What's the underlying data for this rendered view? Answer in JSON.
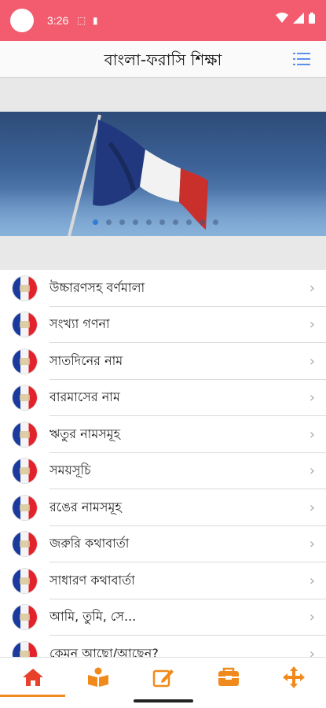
{
  "status_bar": {
    "time": "3:26",
    "icons": [
      "sim-icon",
      "battery-saver-icon",
      "wifi-icon",
      "signal-icon",
      "battery-icon"
    ]
  },
  "app_bar": {
    "title": "বাংলা-ফরাসি শিক্ষা",
    "menu_icon": "list-menu-icon"
  },
  "banner": {
    "image": "french-flag-photo",
    "slide_count": 10,
    "active_slide": 0
  },
  "list": {
    "items": [
      {
        "label": "উচ্চারণসহ বর্ণমালা"
      },
      {
        "label": "সংখ্যা গণনা"
      },
      {
        "label": "সাতদিনের নাম"
      },
      {
        "label": "বারমাসের নাম"
      },
      {
        "label": "ঋতুর নামসমূহ"
      },
      {
        "label": "সময়সূচি"
      },
      {
        "label": "রঙের নামসমূহ"
      },
      {
        "label": "জরুরি কথাবার্তা"
      },
      {
        "label": "সাধারণ কথাবার্তা"
      },
      {
        "label": "আমি, তুমি, সে..."
      },
      {
        "label": "কেমন আছো/আছেন?"
      }
    ],
    "chevron": "›"
  },
  "bottom_nav": {
    "tabs": [
      {
        "icon": "home-icon",
        "active": true
      },
      {
        "icon": "book-reader-icon",
        "active": false
      },
      {
        "icon": "edit-icon",
        "active": false
      },
      {
        "icon": "inbox-icon",
        "active": false
      },
      {
        "icon": "move-arrows-icon",
        "active": false
      }
    ]
  },
  "colors": {
    "status_bar": "#f25c6e",
    "accent": "#f08a1c",
    "home_active": "#e8412b",
    "menu_icon": "#5b8ff0"
  }
}
